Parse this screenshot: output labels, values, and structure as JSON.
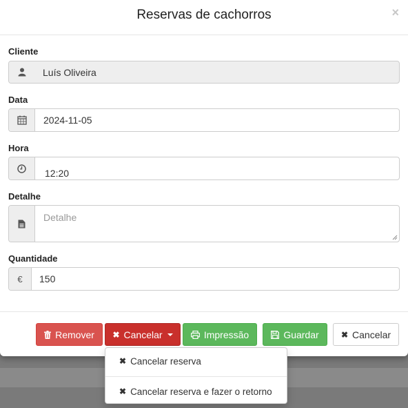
{
  "modal": {
    "title": "Reservas de cachorros",
    "close_glyph": "×"
  },
  "form": {
    "cliente": {
      "label": "Cliente",
      "value": "Luís Oliveira",
      "icon": "user-icon"
    },
    "data": {
      "label": "Data",
      "value": "2024-11-05",
      "icon": "calendar-icon"
    },
    "hora": {
      "label": "Hora",
      "value": "12:20",
      "icon": "clock-icon"
    },
    "detalhe": {
      "label": "Detalhe",
      "placeholder": "Detalhe",
      "icon": "document-icon"
    },
    "quantidade": {
      "label": "Quantidade",
      "value": "150",
      "currency_symbol": "€"
    }
  },
  "footer": {
    "remover": "Remover",
    "cancelar_dropdown": "Cancelar",
    "impressao": "Impressão",
    "guardar": "Guardar",
    "cancelar": "Cancelar"
  },
  "dropdown_menu": {
    "items": [
      "Cancelar reserva",
      "Cancelar reserva e fazer o retorno"
    ]
  },
  "colors": {
    "danger": "#d9534f",
    "danger_active": "#c9302c",
    "success": "#5cb85c"
  }
}
